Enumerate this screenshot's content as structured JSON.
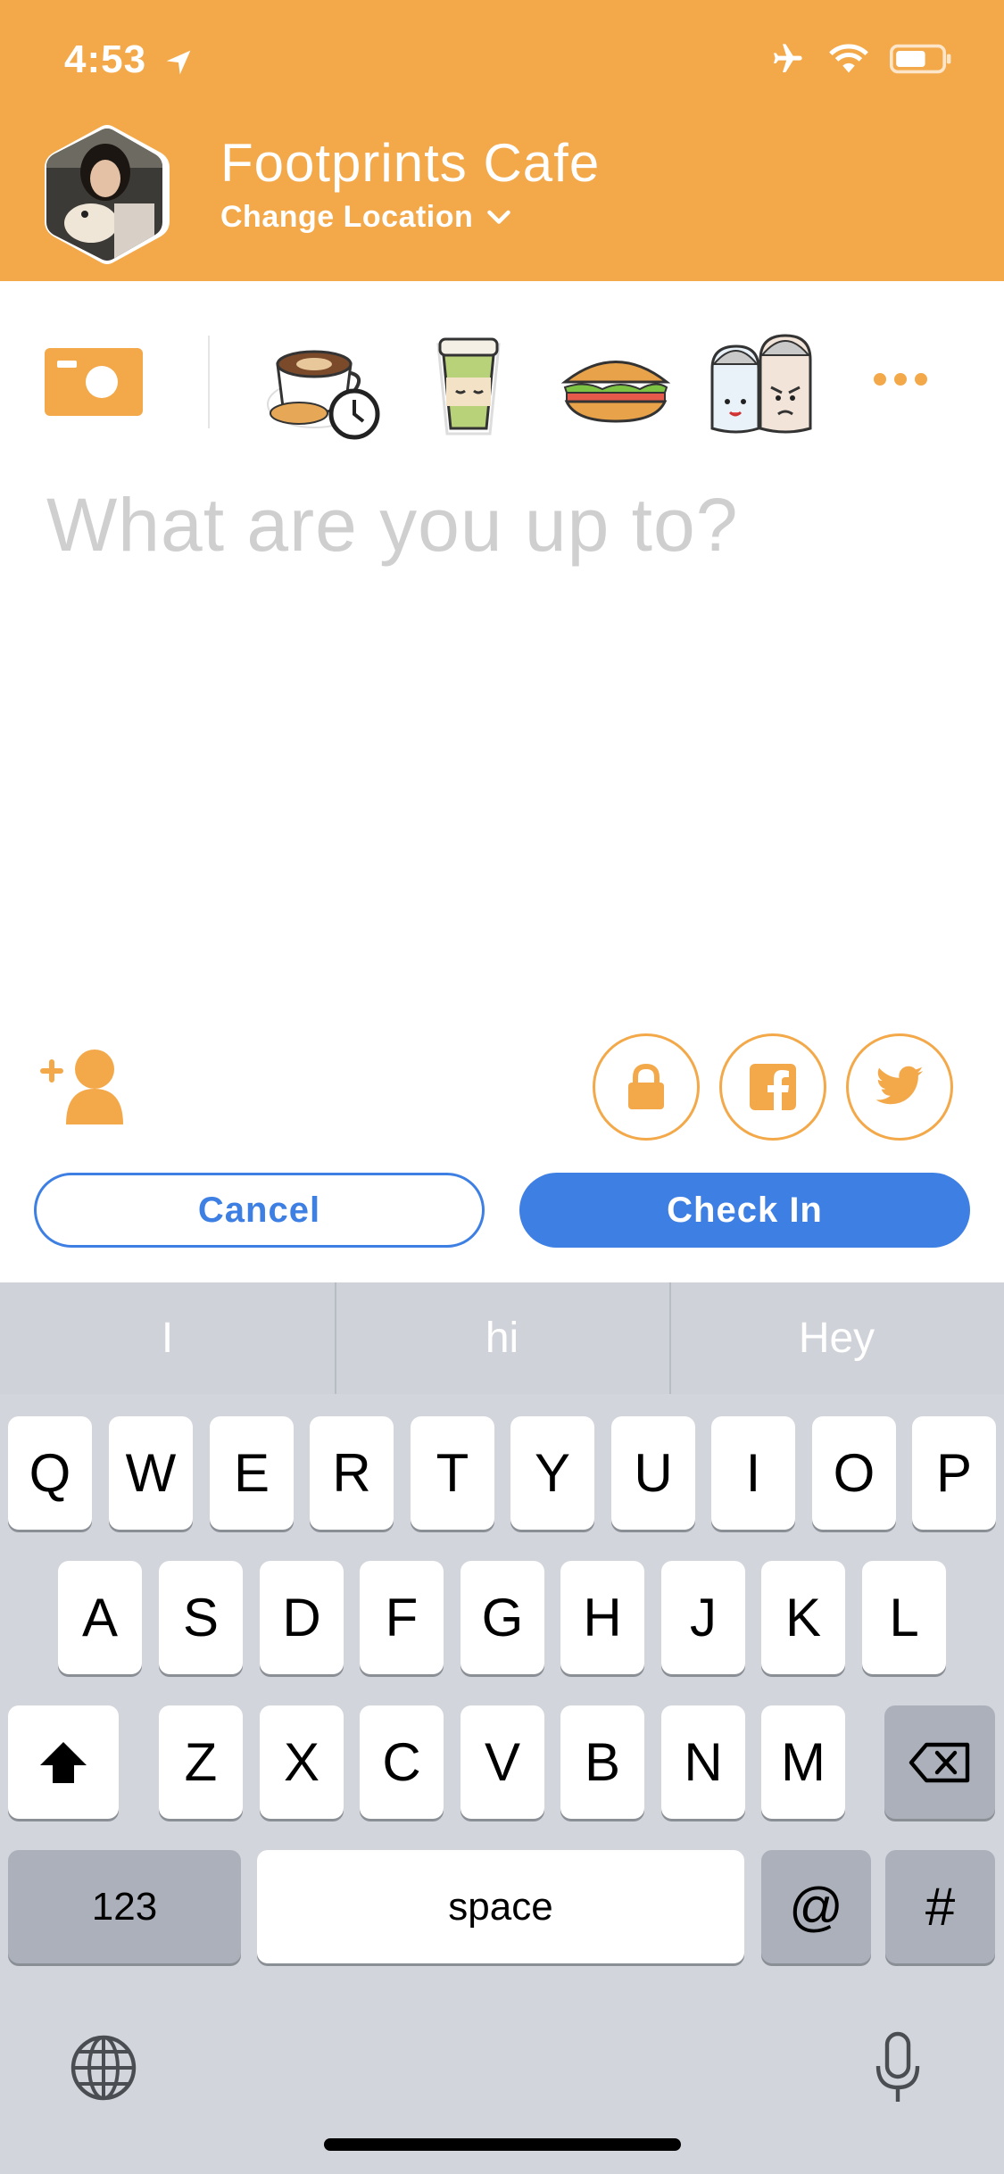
{
  "status_bar": {
    "time": "4:53"
  },
  "header": {
    "venue_name": "Footprints Cafe",
    "change_location_label": "Change Location"
  },
  "stickers": [
    "coffee-clock-sticker",
    "coffee-cup-sticker",
    "sandwich-sticker",
    "salt-pepper-sticker"
  ],
  "compose": {
    "placeholder": "What are you up to?"
  },
  "actions": {
    "cancel_label": "Cancel",
    "checkin_label": "Check In"
  },
  "keyboard": {
    "suggestions": [
      "I",
      "hi",
      "Hey"
    ],
    "row1": [
      "Q",
      "W",
      "E",
      "R",
      "T",
      "Y",
      "U",
      "I",
      "O",
      "P"
    ],
    "row2": [
      "A",
      "S",
      "D",
      "F",
      "G",
      "H",
      "J",
      "K",
      "L"
    ],
    "row3": [
      "Z",
      "X",
      "C",
      "V",
      "B",
      "N",
      "M"
    ],
    "numbers_label": "123",
    "space_label": "space",
    "at_label": "@",
    "hash_label": "#"
  },
  "colors": {
    "brand_orange": "#F3A94A",
    "action_blue": "#3E7FE3"
  }
}
